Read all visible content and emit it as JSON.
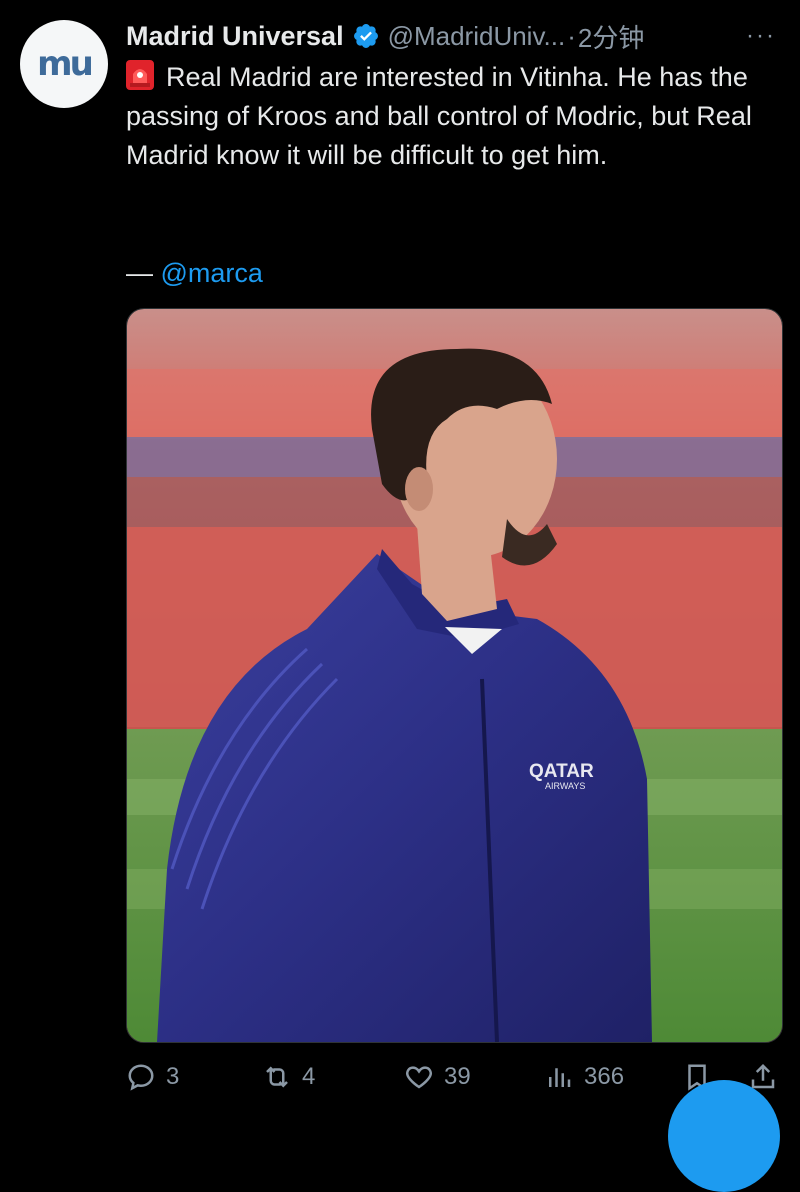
{
  "post": {
    "author_name": "Madrid Universal",
    "author_handle": "@MadridUniv...",
    "time_sep": "·",
    "time_ago": "2分钟",
    "more": "···",
    "avatar_logo": "mu",
    "text": "Real Madrid are interested in Vitinha. He has the passing of Kroos and ball control of Modric, but Real Madrid know it will be difficult to get him.",
    "source_dash": "—",
    "source_mention": "@marca",
    "image_jacket_text_1": "QATAR",
    "image_jacket_text_2": "AIRWAYS"
  },
  "actions": {
    "replies": "3",
    "reposts": "4",
    "likes": "39",
    "views": "366"
  },
  "colors": {
    "background": "#000000",
    "text": "#e7e9ea",
    "muted": "#8b98a5",
    "link": "#1d9bf0",
    "verified": "#1d9bf0"
  },
  "icons": [
    "verified-badge-icon",
    "siren-emoji-icon",
    "reply-icon",
    "repost-icon",
    "like-icon",
    "views-icon",
    "bookmark-icon",
    "share-icon"
  ]
}
